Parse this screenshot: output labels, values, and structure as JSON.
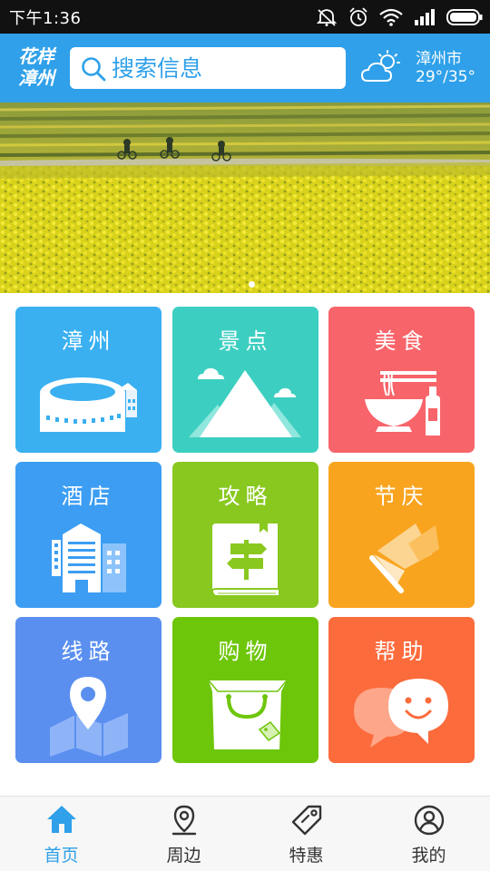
{
  "status_bar": {
    "time": "下午1:36",
    "icons": [
      "mute-icon",
      "alarm-icon",
      "wifi-icon",
      "signal-icon",
      "battery-icon"
    ]
  },
  "header": {
    "logo_line1": "花样",
    "logo_line2": "漳州",
    "search_placeholder": "搜索信息",
    "weather_city": "漳州市",
    "weather_temp": "29°/35°",
    "weather_icon": "cloudy-sun-icon",
    "accent_color": "#2fa0e9"
  },
  "banner": {
    "image": "rapeseed-field-cyclists-photo",
    "page_count": 1,
    "active_page": 1
  },
  "grid": {
    "tiles": [
      {
        "label": "漳州",
        "icon": "stadium-icon",
        "color": "#3ab0f1"
      },
      {
        "label": "景点",
        "icon": "mountain-icon",
        "color": "#3ccfc1"
      },
      {
        "label": "美食",
        "icon": "noodles-bottle-icon",
        "color": "#f7646a"
      },
      {
        "label": "酒店",
        "icon": "hotel-icon",
        "color": "#3c9df3"
      },
      {
        "label": "攻略",
        "icon": "guidebook-icon",
        "color": "#89c81f"
      },
      {
        "label": "节庆",
        "icon": "festival-flag-icon",
        "color": "#f9a41f"
      },
      {
        "label": "线路",
        "icon": "map-pin-icon",
        "color": "#5a8ff0"
      },
      {
        "label": "购物",
        "icon": "shopping-bag-icon",
        "color": "#6ec60a"
      },
      {
        "label": "帮助",
        "icon": "chat-smile-icon",
        "color": "#fc6b3c"
      }
    ]
  },
  "tabbar": {
    "tabs": [
      {
        "label": "首页",
        "icon": "home-icon",
        "active": true
      },
      {
        "label": "周边",
        "icon": "location-pin-icon",
        "active": false
      },
      {
        "label": "特惠",
        "icon": "price-tag-icon",
        "active": false
      },
      {
        "label": "我的",
        "icon": "user-icon",
        "active": false
      }
    ],
    "active_color": "#2fa0e9"
  }
}
